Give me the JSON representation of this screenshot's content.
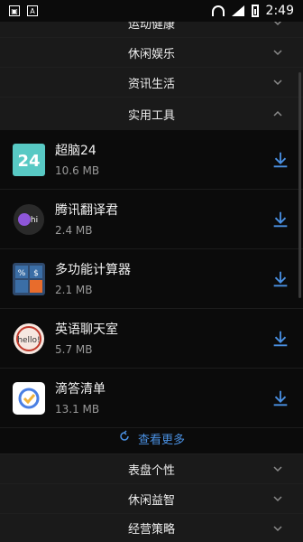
{
  "status_bar": {
    "time": "2:49",
    "left_icons": [
      "photo-icon",
      "app-icon"
    ],
    "right_icons": [
      "wifi-icon",
      "signal-icon",
      "battery-icon"
    ]
  },
  "categories_top": [
    {
      "label": "运动健康"
    },
    {
      "label": "休闲娱乐"
    },
    {
      "label": "资讯生活"
    },
    {
      "label": "实用工具",
      "expanded": true
    }
  ],
  "apps": [
    {
      "name": "超脑24",
      "size": "10.6 MB",
      "icon": "brain24-icon"
    },
    {
      "name": "腾讯翻译君",
      "size": "2.4 MB",
      "icon": "tencent-translate-icon"
    },
    {
      "name": "多功能计算器",
      "size": "2.1 MB",
      "icon": "calculator-icon"
    },
    {
      "name": "英语聊天室",
      "size": "5.7 MB",
      "icon": "chat-hello-icon"
    },
    {
      "name": "滴答清单",
      "size": "13.1 MB",
      "icon": "ticktick-icon"
    }
  ],
  "more_label": "查看更多",
  "categories_bottom": [
    {
      "label": "表盘个性"
    },
    {
      "label": "休闲益智"
    },
    {
      "label": "经营策略"
    }
  ],
  "colors": {
    "accent": "#4a90e2",
    "background": "#0b0b0b",
    "row": "#1a1a1a"
  }
}
